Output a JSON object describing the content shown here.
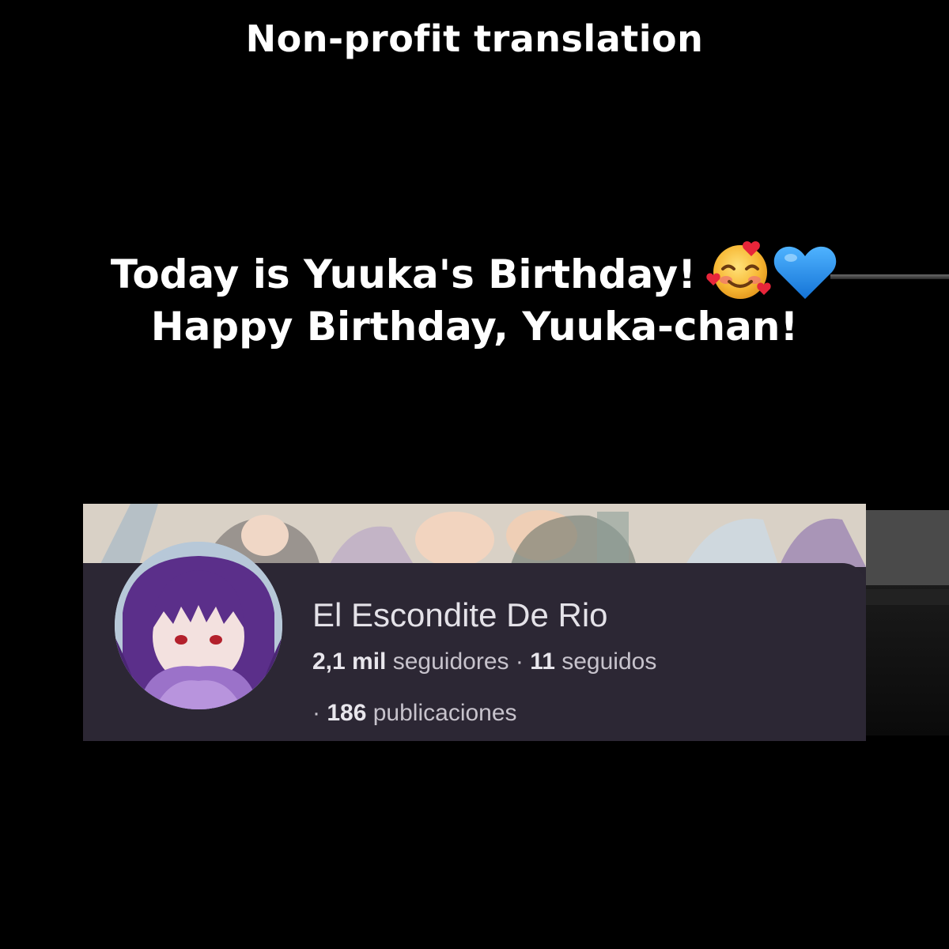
{
  "caption": {
    "top": "Non-profit translation"
  },
  "message": {
    "line1": "Today is Yuuka's Birthday!",
    "line2": "Happy Birthday, Yuuka-chan!"
  },
  "icons": [
    "smiling-face-with-hearts-emoji",
    "blue-heart-emoji"
  ],
  "colors": {
    "background": "#000000",
    "text": "#ffffff",
    "card_bg": "#2c2734",
    "heart_blue": "#1e8fe6",
    "avatar_hair": "#5b2f8a"
  },
  "profile": {
    "name": "El Escondite De Rio",
    "followers_count": "2,1 mil",
    "followers_label": "seguidores",
    "separator": "·",
    "following_count": "11",
    "following_label": "seguidos",
    "posts_count": "186",
    "posts_label": "publicaciones"
  }
}
